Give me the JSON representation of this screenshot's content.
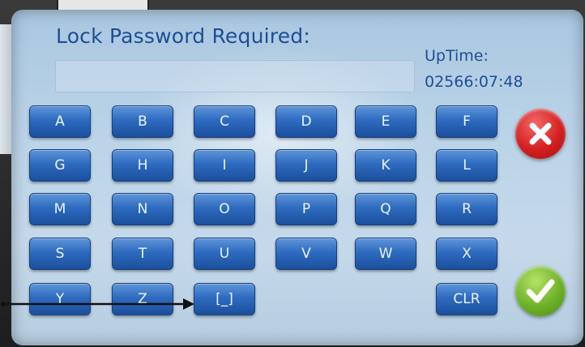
{
  "dialog": {
    "title": "Lock Password Required:",
    "password_value": "",
    "uptime_label": "UpTime:",
    "uptime_value": "02566:07:48"
  },
  "keypad": {
    "rows": [
      [
        "A",
        "B",
        "C",
        "D",
        "E",
        "F"
      ],
      [
        "G",
        "H",
        "I",
        "J",
        "K",
        "L"
      ],
      [
        "M",
        "N",
        "O",
        "P",
        "Q",
        "R"
      ],
      [
        "S",
        "T",
        "U",
        "V",
        "W",
        "X"
      ],
      [
        "Y",
        "Z",
        "[_]",
        "",
        "",
        "CLR"
      ]
    ]
  },
  "buttons": {
    "cancel_icon": "close-icon",
    "confirm_icon": "check-icon"
  },
  "colors": {
    "title_text": "#1e4e93",
    "key_blue": "#2e6bc0",
    "cancel_red": "#d62020",
    "confirm_green": "#6eb22a"
  }
}
